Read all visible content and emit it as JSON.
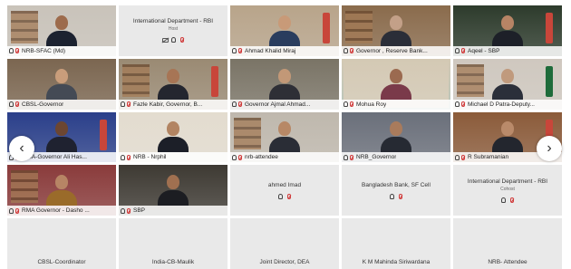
{
  "tiles": [
    {
      "name": "NRB-SFAC (Md)",
      "bg": "#c9c3ba",
      "skin": "#9d6b4c",
      "suit": "#1c2230",
      "type": "video"
    },
    {
      "name": "International Department - RBI",
      "sub": "Host",
      "type": "text"
    },
    {
      "name": "Ahmad Khalid Miraj",
      "bg": "#b8a48a",
      "skin": "#c89a78",
      "suit": "#2a3d5e",
      "type": "video"
    },
    {
      "name": "Governor , Reserve Bank...",
      "bg": "#8a6b4c",
      "skin": "#c3a088",
      "suit": "#2b2e38",
      "type": "video"
    },
    {
      "name": "Aqeel - SBP",
      "bg": "#2d3b2c",
      "skin": "#b78465",
      "suit": "#1d2028",
      "type": "video"
    },
    {
      "name": "CBSL-Governor",
      "bg": "#7b6650",
      "skin": "#c99d7b",
      "suit": "#444a55",
      "type": "video"
    },
    {
      "name": "Fazle Kabir, Governor, B...",
      "bg": "#9a8a73",
      "skin": "#a77555",
      "suit": "#24262f",
      "type": "video"
    },
    {
      "name": "Governor Ajmal Ahmad...",
      "bg": "#7a7466",
      "skin": "#c29877",
      "suit": "#2e2f36",
      "type": "video"
    },
    {
      "name": "Mohua Roy",
      "bg": "#d4c9b4",
      "skin": "#9b6a50",
      "suit": "#7a3a4a",
      "type": "video"
    },
    {
      "name": "Michael D Patra-Deputy...",
      "bg": "#cfc8bf",
      "skin": "#c09a7d",
      "suit": "#2b2f3a",
      "type": "video"
    },
    {
      "name": "MMA-Governor Ali Has...",
      "bg": "#2a3f8a",
      "skin": "#6c4632",
      "suit": "#1f2230",
      "type": "video"
    },
    {
      "name": "NRB - Nrphil",
      "bg": "#e3dccf",
      "skin": "#b28462",
      "suit": "#1c1f28",
      "type": "video"
    },
    {
      "name": "nrb-attendee",
      "bg": "#bfb8ad",
      "skin": "#b78866",
      "suit": "#2a2d36",
      "type": "video"
    },
    {
      "name": "NRB_Governor",
      "bg": "#6a6f7a",
      "skin": "#a97b5c",
      "suit": "#262a33",
      "type": "video"
    },
    {
      "name": "R Subramanian",
      "bg": "#8b5b3a",
      "skin": "#b98a6a",
      "suit": "#23262e",
      "type": "video"
    },
    {
      "name": "RMA Governor - Dasho ...",
      "bg": "#8a3b3b",
      "skin": "#b78565",
      "suit": "#9a6b2a",
      "type": "video"
    },
    {
      "name": "SBP",
      "bg": "#3e3a33",
      "skin": "#a07050",
      "suit": "#1c1d22",
      "type": "video"
    },
    {
      "name": "ahmed Imad",
      "type": "text-icons"
    },
    {
      "name": "Bangladesh Bank, SF Cell",
      "type": "text-icons"
    },
    {
      "name": "International Department - RBI",
      "sub": "Cohost",
      "type": "text"
    },
    {
      "name": "CBSL-Coordinator",
      "type": "bottom"
    },
    {
      "name": "India-CB-Maulik",
      "type": "bottom"
    },
    {
      "name": "Joint Director, DEA",
      "type": "bottom"
    },
    {
      "name": "K M Mahinda Siriwardana",
      "type": "bottom"
    },
    {
      "name": "NRB- Attendee",
      "type": "bottom"
    }
  ],
  "nav": {
    "prev_icon": "chevron-left-icon",
    "next_icon": "chevron-right-icon",
    "prev_glyph": "‹",
    "next_glyph": "›"
  },
  "colors": {
    "active_speaker_border": "#45b8d8",
    "muted_mic": "#d03a3a"
  }
}
